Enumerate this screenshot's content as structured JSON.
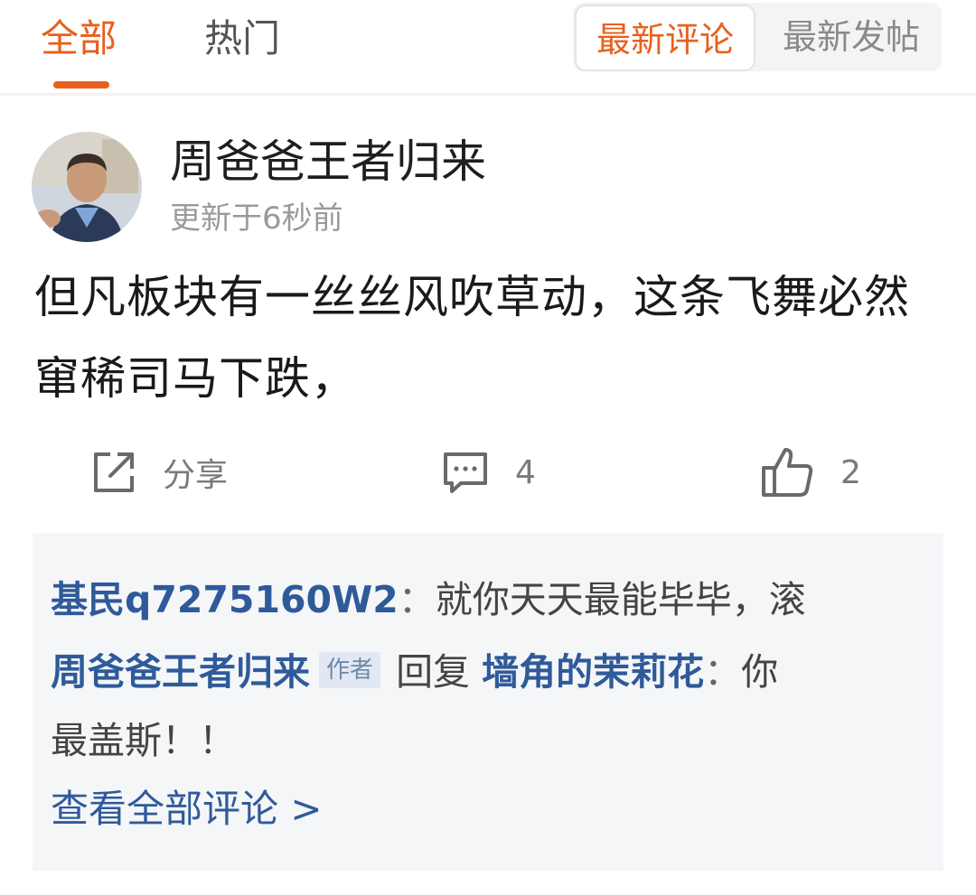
{
  "tabs": [
    {
      "label": "全部",
      "active": true
    },
    {
      "label": "热门",
      "active": false
    }
  ],
  "sort_toggle": {
    "options": [
      "最新评论",
      "最新发帖"
    ],
    "selected": "最新评论"
  },
  "post": {
    "author": "周爸爸王者归来",
    "update_time": "更新于6秒前",
    "content": "但凡板块有一丝丝风吹草动，这条飞舞必然窜稀司马下跌，",
    "actions": {
      "share_label": "分享",
      "comment_count": "4",
      "like_count": "2"
    }
  },
  "comments": {
    "items": [
      {
        "user": "基民q7275160W2",
        "separator": "：",
        "text": "就你天天最能毕毕，滚"
      },
      {
        "user": "周爸爸王者归来",
        "badge": "作者",
        "reply_word": "回复",
        "reply_to": "墙角的茉莉花",
        "separator": "：",
        "text_line1": "你",
        "text_line2": "最盖斯！！"
      }
    ],
    "view_all": "查看全部评论 >"
  },
  "colors": {
    "accent": "#e8601c",
    "link_blue": "#2f5a9a",
    "muted": "#9a9a9a",
    "comment_bg": "#f4f6f8"
  },
  "icons": [
    "share-icon",
    "comment-icon",
    "like-icon"
  ]
}
